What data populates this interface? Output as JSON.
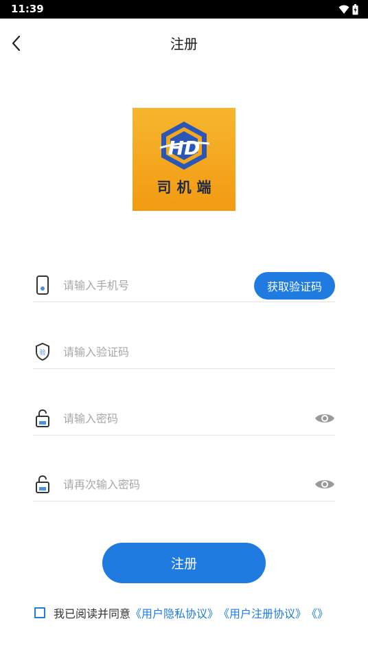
{
  "status_bar": {
    "time": "11:39"
  },
  "nav": {
    "title": "注册"
  },
  "logo": {
    "text": "司机端"
  },
  "form": {
    "phone": {
      "placeholder": "请输入手机号"
    },
    "get_code_label": "获取验证码",
    "code": {
      "placeholder": "请输入验证码"
    },
    "password": {
      "placeholder": "请输入密码"
    },
    "confirm_password": {
      "placeholder": "请再次输入密码"
    }
  },
  "register_label": "注册",
  "agreement": {
    "prefix": "我已阅读并同意",
    "privacy_link": "《用户隐私协议》",
    "register_link": "《用户注册协议》",
    "extra_link": "《》"
  },
  "colors": {
    "accent": "#1f7be0",
    "logo_orange": "#f29a12"
  },
  "icons": [
    "wifi-icon",
    "battery-icon",
    "back-arrow-icon",
    "phone-icon",
    "verify-shield-icon",
    "lock-icon",
    "eye-icon"
  ]
}
